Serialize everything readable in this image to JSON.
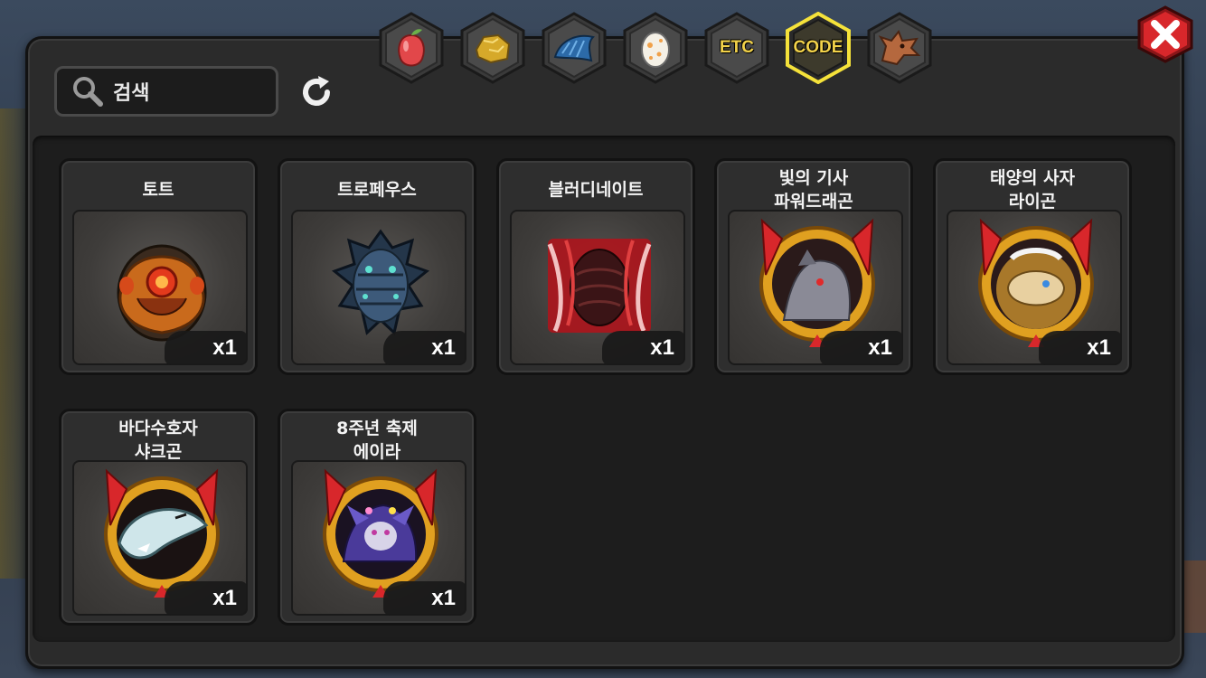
{
  "search": {
    "label": "검색"
  },
  "tabs": [
    {
      "id": "fruit",
      "icon": "fruit-icon",
      "label": ""
    },
    {
      "id": "gold",
      "icon": "gold-ore-icon",
      "label": ""
    },
    {
      "id": "scale",
      "icon": "dragon-scale-icon",
      "label": ""
    },
    {
      "id": "egg",
      "icon": "egg-icon",
      "label": ""
    },
    {
      "id": "etc",
      "icon": "",
      "label": "ETC"
    },
    {
      "id": "code",
      "icon": "",
      "label": "CODE",
      "selected": true
    },
    {
      "id": "dragon",
      "icon": "dragon-head-icon",
      "label": ""
    }
  ],
  "items": [
    {
      "name": "토트",
      "qty": "x1",
      "icon": "thoth-emblem-icon"
    },
    {
      "name": "트로페우스",
      "qty": "x1",
      "icon": "tropeus-dragon-icon"
    },
    {
      "name": "블러디네이트",
      "qty": "x1",
      "icon": "bloodinate-egg-icon"
    },
    {
      "name": "빛의 기사\n파워드래곤",
      "qty": "x1",
      "icon": "power-dragon-portrait-icon"
    },
    {
      "name": "태양의 사자\n라이곤",
      "qty": "x1",
      "icon": "laigon-portrait-icon"
    },
    {
      "name": "바다수호자\n샤크곤",
      "qty": "x1",
      "icon": "sharkgon-portrait-icon"
    },
    {
      "name": "8주년 축제\n에이라",
      "qty": "x1",
      "icon": "eira-portrait-icon"
    }
  ],
  "colors": {
    "selected_tab_border": "#f5e23a",
    "tab_label": "#f2d24a",
    "close_button": "#d8272b",
    "panel_bg": "#2b2b2b"
  }
}
